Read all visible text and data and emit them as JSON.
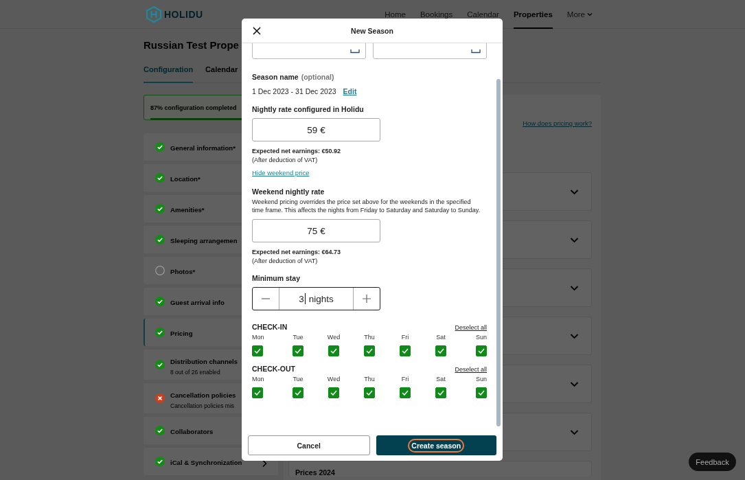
{
  "header": {
    "logo_text": "HOLIDU",
    "nav": [
      {
        "label": "Home",
        "selected": false
      },
      {
        "label": "Bookings",
        "selected": false
      },
      {
        "label": "Calendar",
        "selected": false
      },
      {
        "label": "Properties",
        "selected": true
      },
      {
        "label": "More",
        "selected": false,
        "menu": true
      }
    ]
  },
  "page": {
    "title": "Russian Test Prope",
    "tabs": [
      {
        "label": "Configuration",
        "selected": true
      },
      {
        "label": "Calendar",
        "selected": false
      }
    ],
    "progress": {
      "label": "87% configuration completed",
      "level": 0.87
    },
    "sidebar": [
      {
        "label": "General information*",
        "kind": "done",
        "selected": false
      },
      {
        "label": "Location*",
        "kind": "done",
        "selected": false
      },
      {
        "label": "Amenities*",
        "kind": "done",
        "selected": false
      },
      {
        "label": "Sleeping arrangemen",
        "kind": "done",
        "selected": false
      },
      {
        "label": "Photos*",
        "kind": "todo",
        "selected": false
      },
      {
        "label": "Guest arrival info",
        "kind": "done",
        "selected": false
      },
      {
        "label": "Pricing",
        "kind": "done",
        "selected": true
      },
      {
        "label": "Distribution channels",
        "sublabel": "8 out of 26 enabled",
        "kind": "done",
        "selected": false
      },
      {
        "label": "Cancellation policies",
        "sublabel": "Cancellation policies mis",
        "kind": "error",
        "selected": false
      },
      {
        "label": "Collaborators",
        "kind": "done",
        "selected": false
      },
      {
        "label": "iCal & Synchronization",
        "kind": "done",
        "selected": false,
        "arrow": true
      }
    ],
    "pricing_link": "How does pricing work?",
    "accordions": [
      {
        "expanded": false
      },
      {
        "expanded": false
      },
      {
        "expanded": false
      },
      {
        "expanded": false
      },
      {
        "expanded": false
      },
      {
        "expanded": false
      },
      {
        "title": "Prices 2024"
      }
    ]
  },
  "feedback": "Feedback",
  "modal": {
    "title": "New Season",
    "season_name": {
      "label": "Season name",
      "hint": "(optional)",
      "value": "1 Dec 2023 - 31 Dec 2023",
      "edit": "Edit"
    },
    "nightly": {
      "label": "Nightly rate configured in Holidu",
      "value": "59 €",
      "earnings": "Expected net earnings: €50.92",
      "note": "(After deduction of VAT)"
    },
    "weekend_toggle": "Hide weekend price",
    "weekend": {
      "label": "Weekend nightly rate",
      "description": "Weekend pricing overrides the price set above for the weekends in the specified time frame. This affects the nights from Friday to Saturday and Saturday to Sunday.",
      "value": "75 €",
      "earnings": "Expected net earnings: €64.73",
      "note": "(After deduction of VAT)"
    },
    "min_stay": {
      "label": "Minimum stay",
      "value": "3",
      "unit": "nights",
      "focused": true
    },
    "day_groups": [
      {
        "title": "CHECK-IN",
        "action": "Deselect all",
        "days": [
          {
            "label": "Mon",
            "checked": true
          },
          {
            "label": "Tue",
            "checked": true
          },
          {
            "label": "Wed",
            "checked": true
          },
          {
            "label": "Thu",
            "checked": true
          },
          {
            "label": "Fri",
            "checked": true
          },
          {
            "label": "Sat",
            "checked": true
          },
          {
            "label": "Sun",
            "checked": true
          }
        ]
      },
      {
        "title": "CHECK-OUT",
        "action": "Deselect all",
        "days": [
          {
            "label": "Mon",
            "checked": true
          },
          {
            "label": "Tue",
            "checked": true
          },
          {
            "label": "Wed",
            "checked": true
          },
          {
            "label": "Thu",
            "checked": true
          },
          {
            "label": "Fri",
            "checked": true
          },
          {
            "label": "Sat",
            "checked": true
          },
          {
            "label": "Sun",
            "checked": true
          }
        ]
      }
    ],
    "cancel": "Cancel",
    "submit": {
      "label": "Create season",
      "focused": true
    }
  }
}
